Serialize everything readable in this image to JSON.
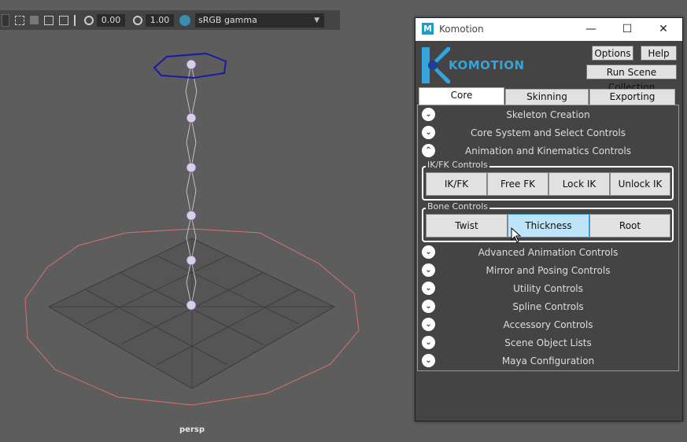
{
  "toolbar": {
    "value_a": "0.00",
    "value_b": "1.00",
    "colorspace": "sRGB gamma"
  },
  "viewport": {
    "camera_label": "persp"
  },
  "window": {
    "title": "Komotion",
    "logo_text": "KOMOTION",
    "header_buttons": {
      "options": "Options",
      "help": "Help",
      "run_scene_collection": "Run Scene Collection"
    },
    "tabs": [
      {
        "label": "Core",
        "active": true
      },
      {
        "label": "Skinning",
        "active": false
      },
      {
        "label": "Exporting",
        "active": false
      }
    ],
    "sections_top": [
      {
        "label": "Skeleton Creation",
        "expanded": false
      },
      {
        "label": "Core System and Select Controls",
        "expanded": false
      },
      {
        "label": "Animation and Kinematics Controls",
        "expanded": true
      }
    ],
    "ikfk_group": {
      "label": "IK/FK Controls",
      "buttons": [
        "IK/FK",
        "Free FK",
        "Lock IK",
        "Unlock IK"
      ]
    },
    "bone_group": {
      "label": "Bone Controls",
      "buttons": [
        "Twist",
        "Thickness",
        "Root"
      ],
      "hovered": "Thickness"
    },
    "sections_bottom": [
      {
        "label": "Advanced Animation Controls"
      },
      {
        "label": "Mirror and Posing Controls"
      },
      {
        "label": "Utility Controls"
      },
      {
        "label": "Spline Controls"
      },
      {
        "label": "Accessory Controls"
      },
      {
        "label": "Scene Object Lists"
      },
      {
        "label": "Maya Configuration"
      }
    ]
  },
  "colors": {
    "accent": "#34a4dc",
    "hover": "#bde4f8",
    "viewport_bg": "#5d5d5d"
  }
}
